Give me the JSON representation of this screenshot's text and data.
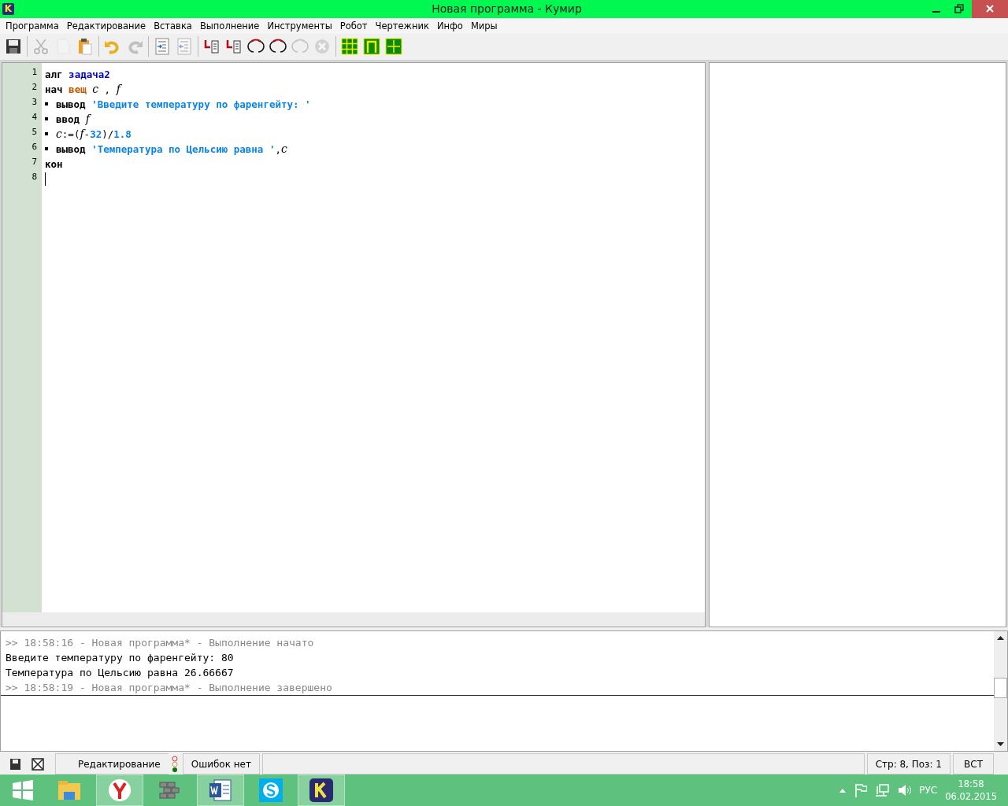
{
  "window": {
    "logo": "K",
    "title": "Новая программа - Кумир"
  },
  "menu": [
    "Программа",
    "Редактирование",
    "Вставка",
    "Выполнение",
    "Инструменты",
    "Робот",
    "Чертежник",
    "Инфо",
    "Миры"
  ],
  "toolbar": [
    [
      {
        "kind": "save",
        "disabled": false
      }
    ],
    [
      {
        "kind": "cut",
        "disabled": true
      },
      {
        "kind": "copy",
        "disabled": true
      },
      {
        "kind": "paste",
        "disabled": false
      }
    ],
    [
      {
        "kind": "undo",
        "disabled": false
      },
      {
        "kind": "redo",
        "disabled": true
      }
    ],
    [
      {
        "kind": "indent",
        "disabled": false
      },
      {
        "kind": "unindent",
        "disabled": true
      }
    ],
    [
      {
        "kind": "run",
        "disabled": false
      },
      {
        "kind": "run-steps",
        "disabled": false
      },
      {
        "kind": "step-over",
        "disabled": false
      },
      {
        "kind": "step-in",
        "disabled": false
      },
      {
        "kind": "step-out",
        "disabled": true
      },
      {
        "kind": "stop",
        "disabled": true
      }
    ],
    [
      {
        "kind": "grid",
        "disabled": false
      },
      {
        "kind": "frame",
        "disabled": false
      },
      {
        "kind": "axes",
        "disabled": false
      }
    ]
  ],
  "code": {
    "lines": [
      {
        "number": "1",
        "indented": false,
        "cursor": false,
        "tokens": [
          {
            "kind": "keyword",
            "text": "алг "
          },
          {
            "kind": "name",
            "text": "задача2"
          }
        ]
      },
      {
        "number": "2",
        "indented": false,
        "cursor": false,
        "tokens": [
          {
            "kind": "keyword",
            "text": "нач "
          },
          {
            "kind": "type",
            "text": "вещ "
          },
          {
            "kind": "var",
            "text": "c"
          },
          {
            "kind": "op",
            "text": " , "
          },
          {
            "kind": "var",
            "text": "f"
          }
        ]
      },
      {
        "number": "3",
        "indented": true,
        "cursor": false,
        "tokens": [
          {
            "kind": "keyword",
            "text": "вывод "
          },
          {
            "kind": "string",
            "text": "'Введите температуру по фаренгейту: '"
          }
        ]
      },
      {
        "number": "4",
        "indented": true,
        "cursor": false,
        "tokens": [
          {
            "kind": "keyword",
            "text": "ввод "
          },
          {
            "kind": "var",
            "text": "f"
          }
        ]
      },
      {
        "number": "5",
        "indented": true,
        "cursor": false,
        "tokens": [
          {
            "kind": "var",
            "text": "c"
          },
          {
            "kind": "op",
            "text": ":=("
          },
          {
            "kind": "var",
            "text": "f"
          },
          {
            "kind": "op",
            "text": "-"
          },
          {
            "kind": "number",
            "text": "32"
          },
          {
            "kind": "op",
            "text": ")/"
          },
          {
            "kind": "number",
            "text": "1.8"
          }
        ]
      },
      {
        "number": "6",
        "indented": true,
        "cursor": false,
        "tokens": [
          {
            "kind": "keyword",
            "text": "вывод "
          },
          {
            "kind": "string",
            "text": "'Температура по Цельсию равна '"
          },
          {
            "kind": "op",
            "text": ","
          },
          {
            "kind": "var",
            "text": "c"
          }
        ]
      },
      {
        "number": "7",
        "indented": false,
        "cursor": false,
        "tokens": [
          {
            "kind": "keyword",
            "text": "кон"
          }
        ]
      },
      {
        "number": "8",
        "indented": false,
        "cursor": true
      }
    ]
  },
  "console": [
    {
      "kind": "system",
      "text": ">> 18:58:16 - Новая программа* - Выполнение начато"
    },
    {
      "kind": "output",
      "text": "Введите температуру по фаренгейту: 80"
    },
    {
      "kind": "output",
      "text": "Температура по Цельсию равна 26.66667"
    },
    {
      "kind": "system",
      "text": ">> 18:58:19 - Новая программа* - Выполнение завершено"
    }
  ],
  "status_bar": {
    "mode": "Редактирование",
    "errors": "Ошибок нет",
    "position": "Стр: 8, Поз: 1",
    "insert_mode": "ВСТ"
  },
  "taskbar": {
    "apps": [
      {
        "kind": "explorer",
        "active": false
      },
      {
        "kind": "browser",
        "active": true
      },
      {
        "kind": "wall",
        "active": false
      },
      {
        "kind": "word",
        "active": true
      },
      {
        "kind": "skype",
        "active": false
      },
      {
        "kind": "kumir",
        "active": true
      }
    ],
    "language": "РУС",
    "time": "18:58",
    "date": "06.02.2015"
  }
}
